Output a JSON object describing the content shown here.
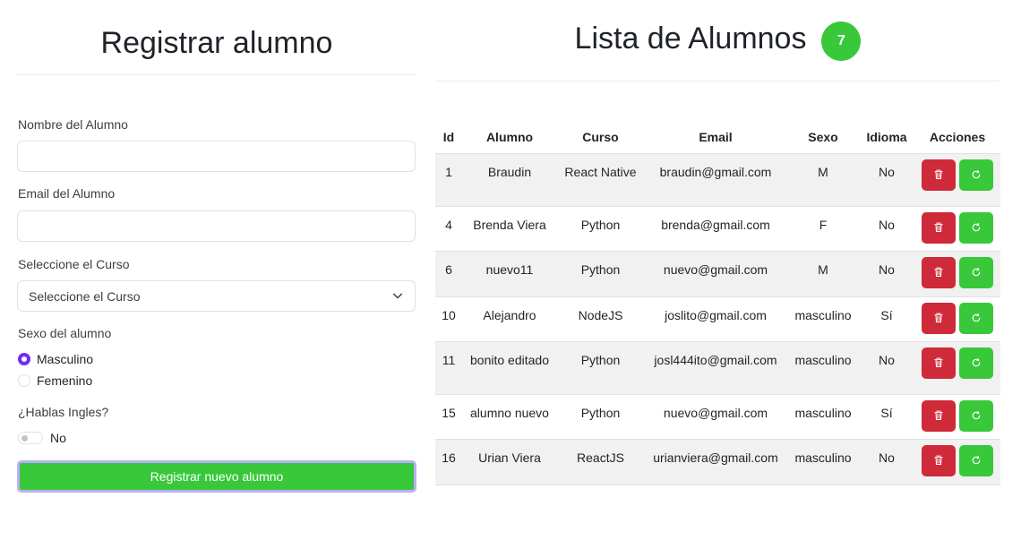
{
  "form": {
    "title": "Registrar alumno",
    "name_label": "Nombre del Alumno",
    "name_value": "",
    "email_label": "Email del Alumno",
    "email_value": "",
    "course_label": "Seleccione el Curso",
    "course_selected": "Seleccione el Curso",
    "sex_label": "Sexo del alumno",
    "sex_options": [
      {
        "label": "Masculino",
        "selected": true
      },
      {
        "label": "Femenino",
        "selected": false
      }
    ],
    "english_label": "¿Hablas Ingles?",
    "english_toggle_label": "No",
    "submit_label": "Registrar nuevo alumno"
  },
  "list": {
    "title": "Lista de Alumnos",
    "count": "7",
    "headers": [
      "Id",
      "Alumno",
      "Curso",
      "Email",
      "Sexo",
      "Idioma",
      "Acciones"
    ],
    "rows": [
      {
        "id": "1",
        "alumno": "Braudin",
        "curso": "React Native",
        "email": "braudin@gmail.com",
        "sexo": "M",
        "idioma": "No"
      },
      {
        "id": "4",
        "alumno": "Brenda Viera",
        "curso": "Python",
        "email": "brenda@gmail.com",
        "sexo": "F",
        "idioma": "No"
      },
      {
        "id": "6",
        "alumno": "nuevo11",
        "curso": "Python",
        "email": "nuevo@gmail.com",
        "sexo": "M",
        "idioma": "No"
      },
      {
        "id": "10",
        "alumno": "Alejandro",
        "curso": "NodeJS",
        "email": "joslito@gmail.com",
        "sexo": "masculino",
        "idioma": "Sí"
      },
      {
        "id": "11",
        "alumno": "bonito editado",
        "curso": "Python",
        "email": "josl444ito@gmail.com",
        "sexo": "masculino",
        "idioma": "No"
      },
      {
        "id": "15",
        "alumno": "alumno nuevo",
        "curso": "Python",
        "email": "nuevo@gmail.com",
        "sexo": "masculino",
        "idioma": "Sí"
      },
      {
        "id": "16",
        "alumno": "Urian Viera",
        "curso": "ReactJS",
        "email": "urianviera@gmail.com",
        "sexo": "masculino",
        "idioma": "No"
      }
    ]
  },
  "colors": {
    "accent_green": "#38c83a",
    "danger_red": "#cf2a3a",
    "radio_purple": "#6f2cf3"
  },
  "icons": {
    "delete": "trash-icon",
    "refresh": "refresh-icon",
    "select": "chevron-down-icon"
  }
}
